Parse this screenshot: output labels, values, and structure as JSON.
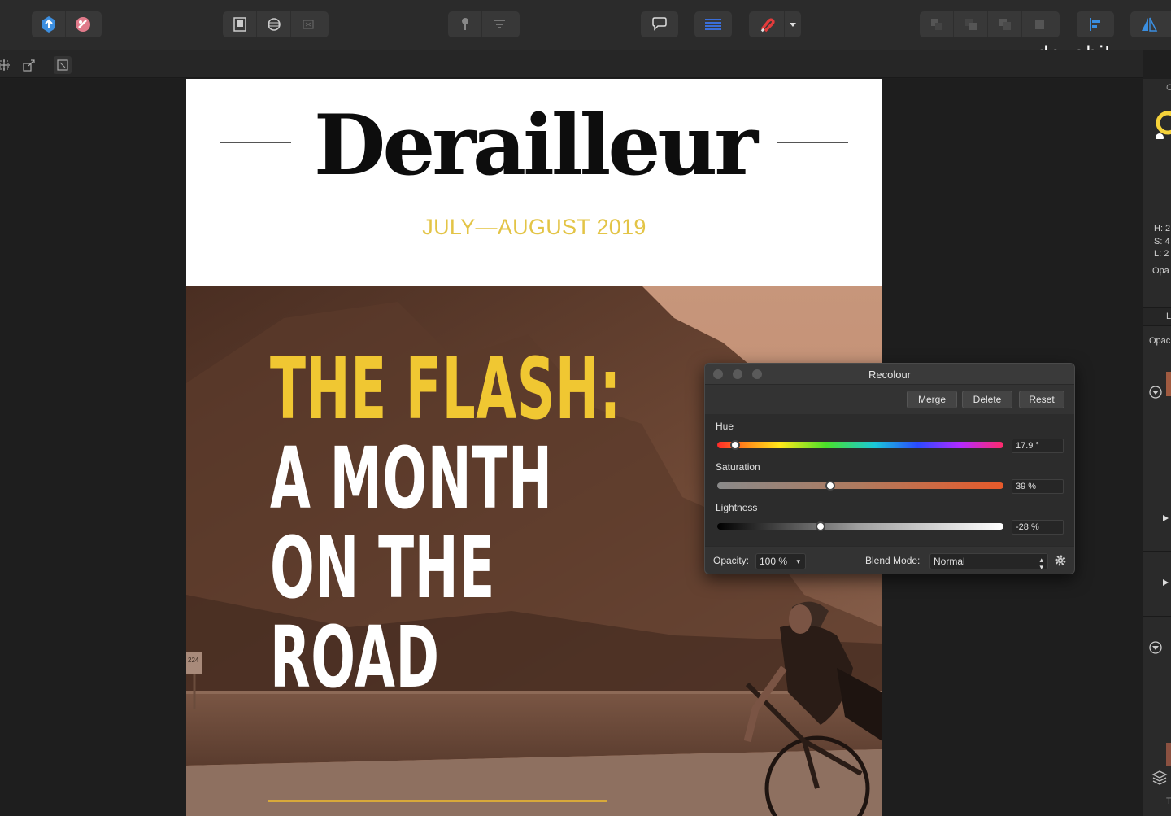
{
  "brand": "devabit",
  "toolbar": {
    "groups": [
      "personas",
      "assistant",
      "view",
      "snapping",
      "arrange",
      "align",
      "transform"
    ]
  },
  "document": {
    "masthead_title": "Derailleur",
    "masthead_date": "JULY—AUGUST 2019",
    "headline": [
      "THE FLASH:",
      "A MONTH",
      "ON THE",
      "ROAD"
    ],
    "sign": "224"
  },
  "recolour": {
    "title": "Recolour",
    "buttons": {
      "merge": "Merge",
      "delete": "Delete",
      "reset": "Reset"
    },
    "hue": {
      "label": "Hue",
      "value": "17.9 °",
      "position": 0.062
    },
    "saturation": {
      "label": "Saturation",
      "value": "39 %",
      "position": 0.395
    },
    "lightness": {
      "label": "Lightness",
      "value": "-28 %",
      "position": 0.36
    },
    "opacity": {
      "label": "Opacity:",
      "value": "100 %"
    },
    "blend_mode": {
      "label": "Blend Mode:",
      "value": "Normal"
    }
  },
  "right_panel": {
    "h": "H: 2",
    "s": "S: 4",
    "l": "L: 2",
    "opacity_1": "Opa",
    "tab_l": "L",
    "opacity_2": "Opac",
    "top_letter": "C",
    "bottom_letter": "T"
  }
}
